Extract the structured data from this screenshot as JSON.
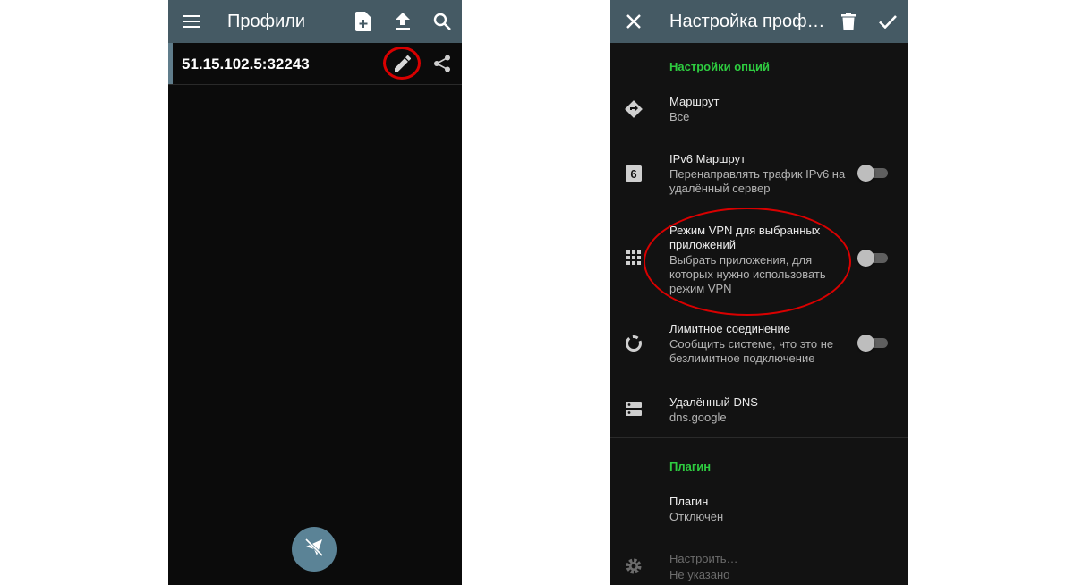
{
  "left": {
    "title": "Профили",
    "icons": {
      "menu": "menu-icon",
      "add_file": "add-file-icon",
      "upload": "upload-icon",
      "search": "search-icon",
      "edit": "edit-icon",
      "share": "share-icon",
      "fab": "connect-icon"
    },
    "profile": {
      "name": "51.15.102.5:32243"
    },
    "colors": {
      "toolbar": "#455a64",
      "fab": "#5b8396",
      "annotation": "#d90000"
    }
  },
  "right": {
    "title": "Настройка проф…",
    "icons": {
      "close": "close-icon",
      "delete": "delete-icon",
      "confirm": "check-icon"
    },
    "section_options": "Настройки опций",
    "items": [
      {
        "title": "Маршрут",
        "subtitle": "Все",
        "icon": "route-icon"
      },
      {
        "title": "IPv6 Маршрут",
        "subtitle": "Перенаправлять трафик IPv6 на удалённый сервер",
        "icon": "ipv6-icon",
        "toggle": false
      },
      {
        "title": "Режим VPN для выбранных приложений",
        "subtitle": "Выбрать приложения, для которых нужно использовать режим VPN",
        "icon": "apps-grid-icon",
        "toggle": false
      },
      {
        "title": "Лимитное соединение",
        "subtitle": "Сообщить системе, что это не безлимитное подключение",
        "icon": "metered-icon",
        "toggle": false
      },
      {
        "title": "Удалённый DNS",
        "subtitle": "dns.google",
        "icon": "dns-icon"
      }
    ],
    "section_plugin": "Плагин",
    "plugin": {
      "title": "Плагин",
      "subtitle": "Отключён"
    },
    "configure": {
      "title": "Настроить…",
      "subtitle": "Не указано",
      "icon": "gear-icon"
    },
    "colors": {
      "section": "#2ecc40",
      "toolbar": "#455a64"
    }
  }
}
